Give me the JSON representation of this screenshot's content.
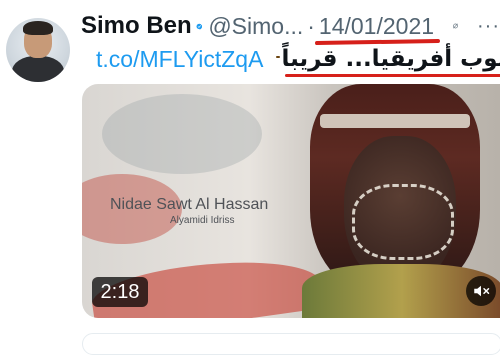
{
  "tweet": {
    "author_name": "Simo Ben",
    "handle": "@Simo...",
    "separator": "·",
    "date": "14/01/2021",
    "link_text": "t.co/MFLYictZqA",
    "arabic_text": "جنوب أفريقيا... قريباً",
    "more_label": "···"
  },
  "media": {
    "caption_title": "Nidae Sawt Al Hassan",
    "caption_sub": "Alyamidi Idriss",
    "duration": "2:18"
  },
  "colors": {
    "accent": "#1d9bf0",
    "annotation": "#d6201a",
    "secondary_text": "#536471"
  },
  "icons": {
    "verified": "verified-badge-icon",
    "edited": "edited-icon",
    "more": "more-icon",
    "mute": "mute-icon",
    "emoji": "winking-face-emoji"
  }
}
